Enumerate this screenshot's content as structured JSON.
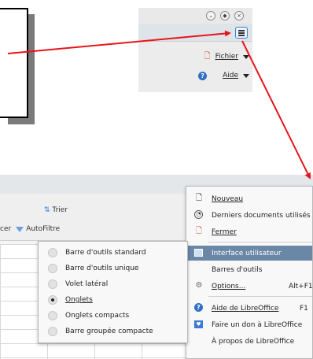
{
  "top_menu": {
    "items": [
      {
        "label": "Fichier",
        "icon": "file-icon"
      },
      {
        "label": "Aide",
        "icon": "help-icon"
      }
    ],
    "window_buttons": [
      "minimize-icon",
      "restore-icon",
      "close-icon"
    ],
    "menu_button_icon": "hamburger-icon"
  },
  "toolbar": {
    "trier_label": "Trier",
    "cer_label": "cer",
    "autofiltre_label": "AutoFiltre"
  },
  "menu": {
    "items": [
      {
        "label": "Nouveau",
        "shortcut": ""
      },
      {
        "label": "Derniers documents utilisés",
        "shortcut": ""
      },
      {
        "label": "Fermer",
        "shortcut": ""
      },
      {
        "label": "Interface utilisateur",
        "shortcut": "",
        "highlighted": true
      },
      {
        "label": "Barres d'outils",
        "shortcut": ""
      },
      {
        "label": "Options...",
        "shortcut": "Alt+F12"
      },
      {
        "label": "Aide de LibreOffice",
        "shortcut": "F1"
      },
      {
        "label": "Faire un don à LibreOffice",
        "shortcut": ""
      },
      {
        "label": "À propos de LibreOffice",
        "shortcut": ""
      }
    ]
  },
  "submenu": {
    "items": [
      {
        "label": "Barre d'outils standard",
        "selected": false
      },
      {
        "label": "Barre d'outils unique",
        "selected": false
      },
      {
        "label": "Volet latéral",
        "selected": false
      },
      {
        "label": "Onglets",
        "selected": true
      },
      {
        "label": "Onglets compacts",
        "selected": false
      },
      {
        "label": "Barre groupée compacte",
        "selected": false
      }
    ]
  },
  "colors": {
    "arrow": "#e8141b",
    "highlight": "#6a87a8",
    "accent": "#3a7bd5"
  }
}
